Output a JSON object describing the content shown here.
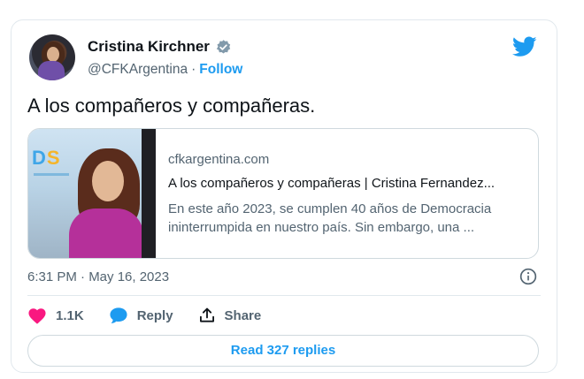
{
  "author": {
    "name": "Cristina Kirchner",
    "handle": "@CFKArgentina",
    "separator": "·",
    "follow_label": "Follow"
  },
  "tweet": {
    "text": "A los compañeros y compañeras.",
    "timestamp": "6:31 PM · May 16, 2023"
  },
  "link_card": {
    "domain": "cfkargentina.com",
    "title": "A los compañeros y compañeras | Cristina Fernandez...",
    "description_line1": "En este año 2023, se cumplen 40 años de Democracia",
    "description_line2": "ininterrumpida en nuestro país. Sin embargo, una ...",
    "thumb_logo": "DS"
  },
  "actions": {
    "like_count": "1.1K",
    "reply_label": "Reply",
    "share_label": "Share"
  },
  "read_replies_label": "Read 327 replies",
  "colors": {
    "accent": "#1d9bf0",
    "like": "#f91880",
    "text": "#0f1419",
    "secondary": "#536471"
  },
  "icons": [
    "verified-badge-icon",
    "twitter-bird-icon",
    "info-icon",
    "heart-icon",
    "reply-bubble-icon",
    "share-icon"
  ]
}
